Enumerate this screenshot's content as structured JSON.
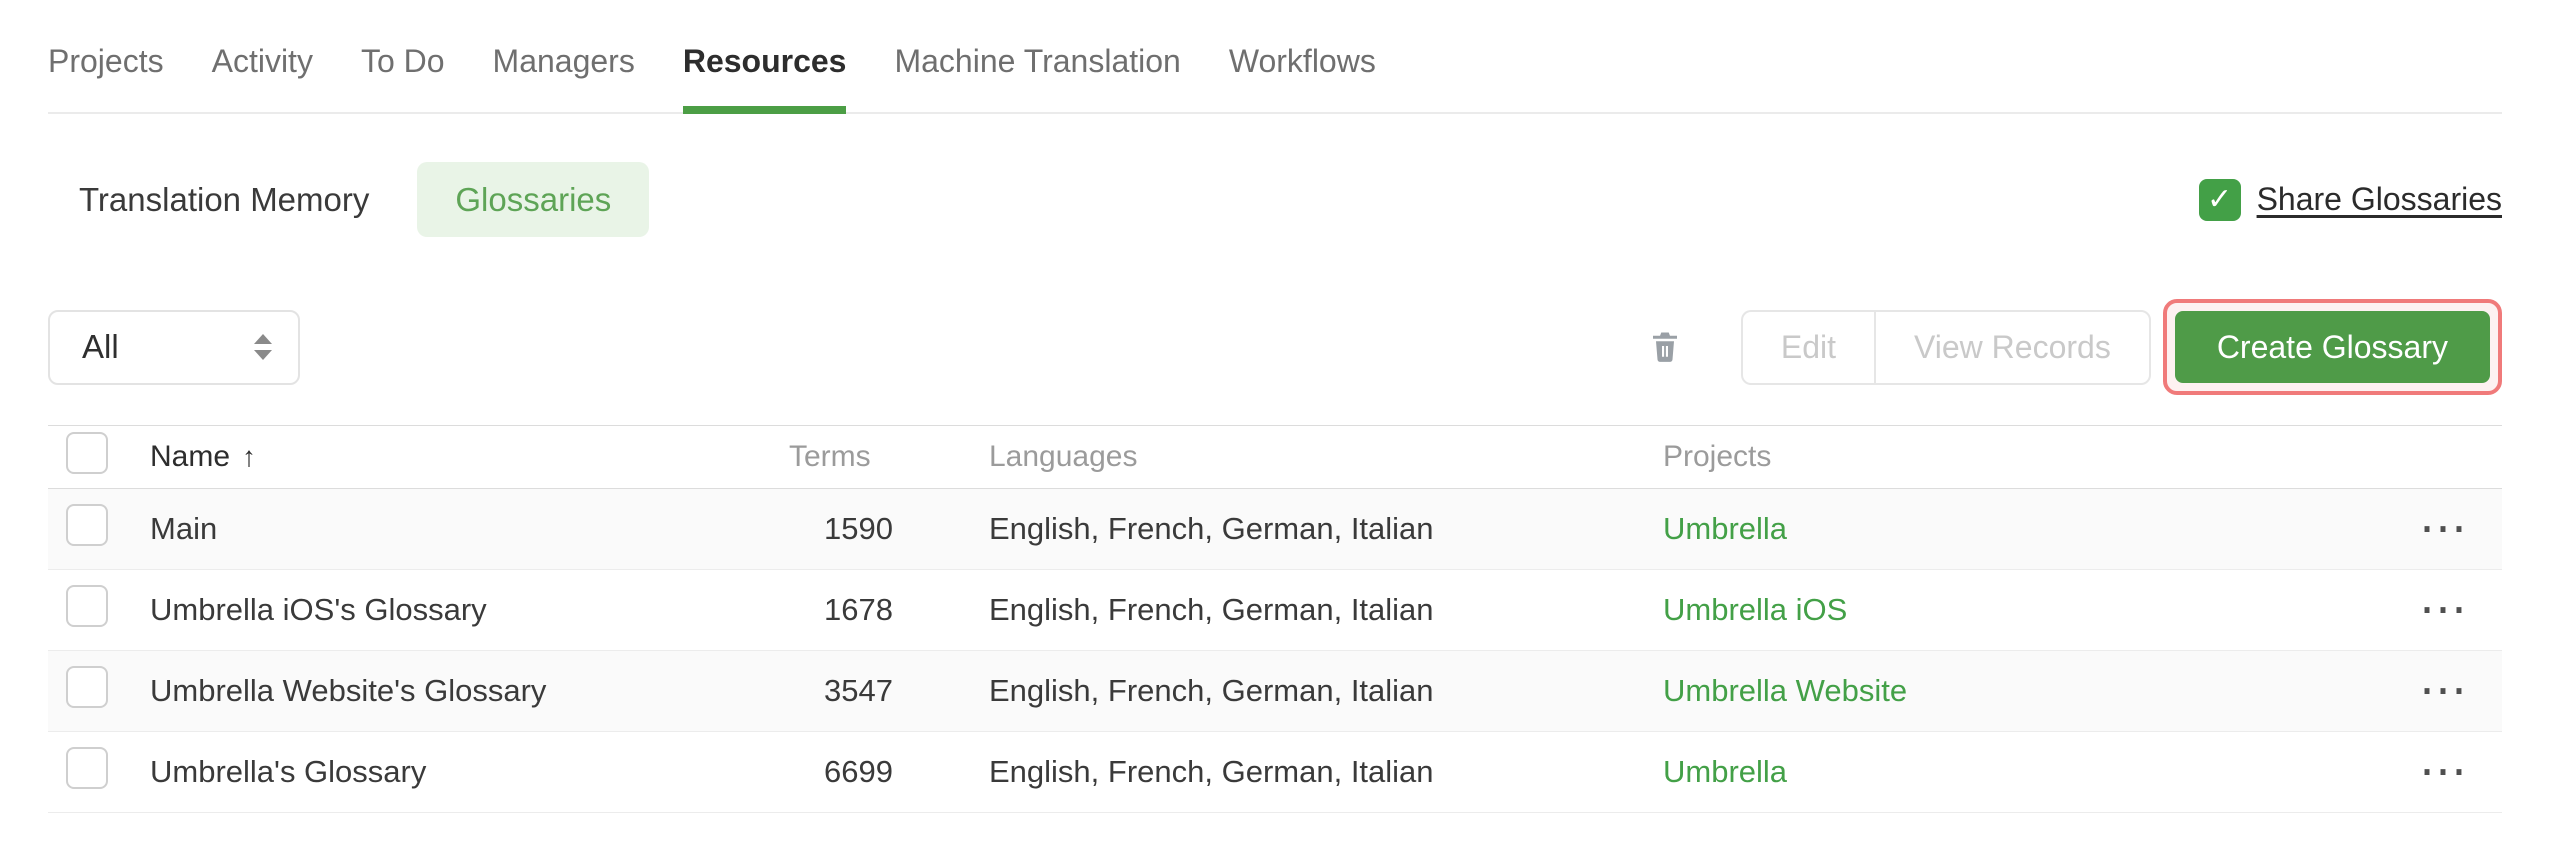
{
  "nav": {
    "tabs": [
      {
        "label": "Projects",
        "active": false
      },
      {
        "label": "Activity",
        "active": false
      },
      {
        "label": "To Do",
        "active": false
      },
      {
        "label": "Managers",
        "active": false
      },
      {
        "label": "Resources",
        "active": true
      },
      {
        "label": "Machine Translation",
        "active": false
      },
      {
        "label": "Workflows",
        "active": false
      }
    ]
  },
  "subnav": {
    "tabs": [
      {
        "label": "Translation Memory",
        "active": false
      },
      {
        "label": "Glossaries",
        "active": true
      }
    ],
    "share": {
      "label": "Share Glossaries",
      "checked": true
    }
  },
  "toolbar": {
    "filter": {
      "value": "All"
    },
    "edit_label": "Edit",
    "view_records_label": "View Records",
    "create_glossary_label": "Create Glossary"
  },
  "table": {
    "columns": {
      "name": "Name",
      "terms": "Terms",
      "languages": "Languages",
      "projects": "Projects"
    },
    "sort": {
      "column": "Name",
      "direction": "asc"
    },
    "rows": [
      {
        "name": "Main",
        "terms": "1590",
        "languages": "English, French, German, Italian",
        "project": "Umbrella"
      },
      {
        "name": "Umbrella iOS's Glossary",
        "terms": "1678",
        "languages": "English, French, German, Italian",
        "project": "Umbrella iOS"
      },
      {
        "name": "Umbrella Website's Glossary",
        "terms": "3547",
        "languages": "English, French, German, Italian",
        "project": "Umbrella Website"
      },
      {
        "name": "Umbrella's Glossary",
        "terms": "6699",
        "languages": "English, French, German, Italian",
        "project": "Umbrella"
      }
    ]
  },
  "icons": {
    "share_check": "✓",
    "sort_asc_arrow": "↑",
    "row_menu": "⋯"
  },
  "colors": {
    "accent_green": "#4c9e45",
    "button_green": "#4f9b48",
    "link_green": "#43a047",
    "pill_bg": "#e9f4e7",
    "pill_text": "#5ea456",
    "highlight_red": "#f07a7a",
    "disabled_text": "#c9c9c9"
  }
}
